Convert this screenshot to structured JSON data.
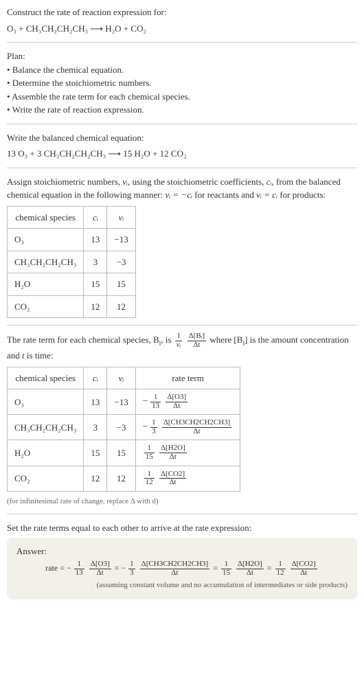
{
  "header": {
    "prompt": "Construct the rate of reaction expression for:",
    "equation": "O₃ + CH₃CH₂CH₂CH₃  ⟶  H₂O + CO₂"
  },
  "plan": {
    "title": "Plan:",
    "items": [
      "• Balance the chemical equation.",
      "• Determine the stoichiometric numbers.",
      "• Assemble the rate term for each chemical species.",
      "• Write the rate of reaction expression."
    ]
  },
  "balanced": {
    "title": "Write the balanced chemical equation:",
    "equation": "13 O₃ + 3 CH₃CH₂CH₂CH₃  ⟶  15 H₂O + 12 CO₂"
  },
  "stoich": {
    "intro_a": "Assign stoichiometric numbers, ",
    "intro_b": ", using the stoichiometric coefficients, ",
    "intro_c": ", from the balanced chemical equation in the following manner: ",
    "intro_d": " for reactants and ",
    "intro_e": " for products:",
    "nu": "νᵢ",
    "ci": "cᵢ",
    "eq_react": "νᵢ = −cᵢ",
    "eq_prod": "νᵢ = cᵢ",
    "headers": [
      "chemical species",
      "cᵢ",
      "νᵢ"
    ],
    "rows": [
      {
        "species": "O₃",
        "c": "13",
        "nu": "−13"
      },
      {
        "species": "CH₃CH₂CH₂CH₃",
        "c": "3",
        "nu": "−3"
      },
      {
        "species": "H₂O",
        "c": "15",
        "nu": "15"
      },
      {
        "species": "CO₂",
        "c": "12",
        "nu": "12"
      }
    ]
  },
  "rateterm": {
    "intro_a": "The rate term for each chemical species, B",
    "intro_b": ", is ",
    "intro_c": " where [B",
    "intro_d": "] is the amount concentration and ",
    "intro_e": " is time:",
    "t": "t",
    "frac1_num": "1",
    "frac1_den": "νᵢ",
    "frac2_num": "Δ[Bᵢ]",
    "frac2_den": "Δt",
    "headers": [
      "chemical species",
      "cᵢ",
      "νᵢ",
      "rate term"
    ],
    "rows": [
      {
        "species": "O₃",
        "c": "13",
        "nu": "−13",
        "sign": "−",
        "a": "1",
        "b": "13",
        "num": "Δ[O3]",
        "den": "Δt"
      },
      {
        "species": "CH₃CH₂CH₂CH₃",
        "c": "3",
        "nu": "−3",
        "sign": "−",
        "a": "1",
        "b": "3",
        "num": "Δ[CH3CH2CH2CH3]",
        "den": "Δt"
      },
      {
        "species": "H₂O",
        "c": "15",
        "nu": "15",
        "sign": "",
        "a": "1",
        "b": "15",
        "num": "Δ[H2O]",
        "den": "Δt"
      },
      {
        "species": "CO₂",
        "c": "12",
        "nu": "12",
        "sign": "",
        "a": "1",
        "b": "12",
        "num": "Δ[CO2]",
        "den": "Δt"
      }
    ],
    "note": "(for infinitesimal rate of change, replace Δ with d)"
  },
  "final": {
    "prompt": "Set the rate terms equal to each other to arrive at the rate expression:",
    "answer_label": "Answer:",
    "rate_label": "rate = ",
    "eq": " = ",
    "terms": [
      {
        "sign": "−",
        "a": "1",
        "b": "13",
        "num": "Δ[O3]",
        "den": "Δt"
      },
      {
        "sign": "−",
        "a": "1",
        "b": "3",
        "num": "Δ[CH3CH2CH2CH3]",
        "den": "Δt"
      },
      {
        "sign": "",
        "a": "1",
        "b": "15",
        "num": "Δ[H2O]",
        "den": "Δt"
      },
      {
        "sign": "",
        "a": "1",
        "b": "12",
        "num": "Δ[CO2]",
        "den": "Δt"
      }
    ],
    "note": "(assuming constant volume and no accumulation of intermediates or side products)"
  }
}
